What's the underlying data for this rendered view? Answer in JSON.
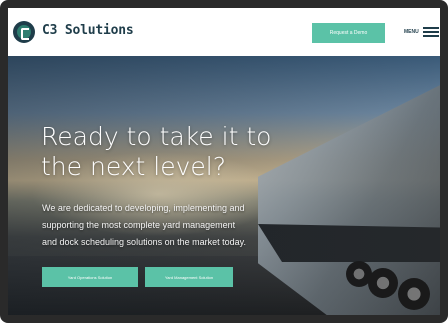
{
  "header": {
    "brand": "C3 Solutions",
    "cta_label": "Request a Demo",
    "menu_label": "MENU"
  },
  "hero": {
    "headline_line1": "Ready to take it to",
    "headline_line2": "the next level?",
    "subtext_line1": "We are dedicated to developing, implementing and",
    "subtext_line2": "supporting the most complete yard management",
    "subtext_line3": "and dock scheduling solutions on the market today.",
    "button_1": "Yard Operations Solution",
    "button_2": "Yard Management Solution"
  },
  "colors": {
    "brand_dark": "#1f3d4a",
    "accent": "#5bc2a7",
    "frame": "#2a2a2a"
  }
}
